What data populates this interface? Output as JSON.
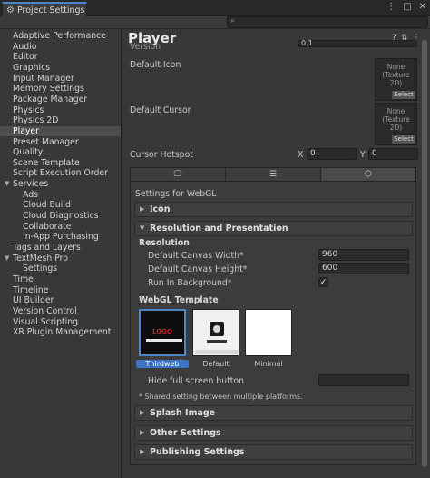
{
  "window": {
    "tab_title": "Project Settings"
  },
  "sidebar": {
    "items": [
      {
        "label": "Adaptive Performance"
      },
      {
        "label": "Audio"
      },
      {
        "label": "Editor"
      },
      {
        "label": "Graphics"
      },
      {
        "label": "Input Manager"
      },
      {
        "label": "Memory Settings"
      },
      {
        "label": "Package Manager"
      },
      {
        "label": "Physics"
      },
      {
        "label": "Physics 2D"
      },
      {
        "label": "Player"
      },
      {
        "label": "Preset Manager"
      },
      {
        "label": "Quality"
      },
      {
        "label": "Scene Template"
      },
      {
        "label": "Script Execution Order"
      },
      {
        "label": "Services"
      },
      {
        "label": "Ads"
      },
      {
        "label": "Cloud Build"
      },
      {
        "label": "Cloud Diagnostics"
      },
      {
        "label": "Collaborate"
      },
      {
        "label": "In-App Purchasing"
      },
      {
        "label": "Tags and Layers"
      },
      {
        "label": "TextMesh Pro"
      },
      {
        "label": "Settings"
      },
      {
        "label": "Time"
      },
      {
        "label": "Timeline"
      },
      {
        "label": "UI Builder"
      },
      {
        "label": "Version Control"
      },
      {
        "label": "Visual Scripting"
      },
      {
        "label": "XR Plugin Management"
      }
    ]
  },
  "main": {
    "title": "Player",
    "version_label": "Version",
    "version_value": "0.1",
    "default_icon_label": "Default Icon",
    "default_cursor_label": "Default Cursor",
    "slot_none": "None",
    "slot_type": "(Texture 2D)",
    "select_label": "Select",
    "cursor_hotspot_label": "Cursor Hotspot",
    "x_label": "X",
    "y_label": "Y",
    "hotspot_x": "0",
    "hotspot_y": "0",
    "settings_for": "Settings for WebGL",
    "icon_section": "Icon",
    "resolution_section": "Resolution and Presentation",
    "resolution_sub": "Resolution",
    "canvas_width_label": "Default Canvas Width*",
    "canvas_width_value": "960",
    "canvas_height_label": "Default Canvas Height*",
    "canvas_height_value": "600",
    "run_bg_label": "Run In Background*",
    "run_bg_checked": "✓",
    "webgl_template_label": "WebGL Template",
    "templates": [
      {
        "caption": "Thirdweb",
        "selected": true
      },
      {
        "caption": "Default",
        "selected": false
      },
      {
        "caption": "Minimal",
        "selected": false
      }
    ],
    "logo_text": "LOGO",
    "hide_fullscreen_label": "Hide full screen button",
    "shared_note": "* Shared setting between multiple platforms.",
    "splash_section": "Splash Image",
    "other_section": "Other Settings",
    "publishing_section": "Publishing Settings"
  },
  "colors": {
    "accent": "#3d74c6",
    "tab_highlight": "#4a86c8"
  }
}
